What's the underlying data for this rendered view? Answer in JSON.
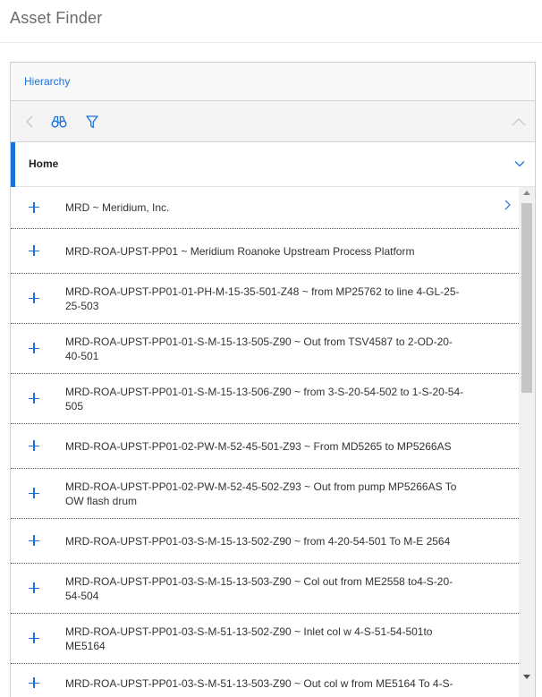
{
  "app": {
    "title": "Asset Finder"
  },
  "tabs": [
    {
      "label": "Hierarchy"
    }
  ],
  "toolbar": {
    "icons": [
      "back-icon",
      "binoculars-icon",
      "filter-icon",
      "collapse-icon"
    ]
  },
  "home": {
    "label": "Home"
  },
  "colors": {
    "accent": "#1a73d9",
    "divider": "#555555"
  },
  "rows": [
    {
      "label": "MRD ~ Meridium, Inc.",
      "has_nav": true
    },
    {
      "label": "MRD-ROA-UPST-PP01 ~ Meridium Roanoke Upstream Process Platform",
      "has_nav": false
    },
    {
      "label": "MRD-ROA-UPST-PP01-01-PH-M-15-35-501-Z48 ~ from MP25762 to line 4-GL-25-25-503",
      "has_nav": false
    },
    {
      "label": "MRD-ROA-UPST-PP01-01-S-M-15-13-505-Z90 ~ Out from TSV4587 to 2-OD-20-40-501",
      "has_nav": false
    },
    {
      "label": "MRD-ROA-UPST-PP01-01-S-M-15-13-506-Z90 ~ from 3-S-20-54-502 to 1-S-20-54-505",
      "has_nav": false
    },
    {
      "label": "MRD-ROA-UPST-PP01-02-PW-M-52-45-501-Z93 ~ From MD5265 to MP5266AS",
      "has_nav": false
    },
    {
      "label": "MRD-ROA-UPST-PP01-02-PW-M-52-45-502-Z93 ~ Out from pump MP5266AS To OW flash drum",
      "has_nav": false
    },
    {
      "label": "MRD-ROA-UPST-PP01-03-S-M-15-13-502-Z90 ~ from 4-20-54-501 To M-E 2564",
      "has_nav": false
    },
    {
      "label": "MRD-ROA-UPST-PP01-03-S-M-15-13-503-Z90 ~ Col out from ME2558 to4-S-20-54-504",
      "has_nav": false
    },
    {
      "label": "MRD-ROA-UPST-PP01-03-S-M-51-13-502-Z90 ~ Inlet col w 4-S-51-54-501to ME5164",
      "has_nav": false
    },
    {
      "label": "MRD-ROA-UPST-PP01-03-S-M-51-13-503-Z90 ~ Out col w from ME5164 To 4-S-",
      "has_nav": false
    }
  ]
}
